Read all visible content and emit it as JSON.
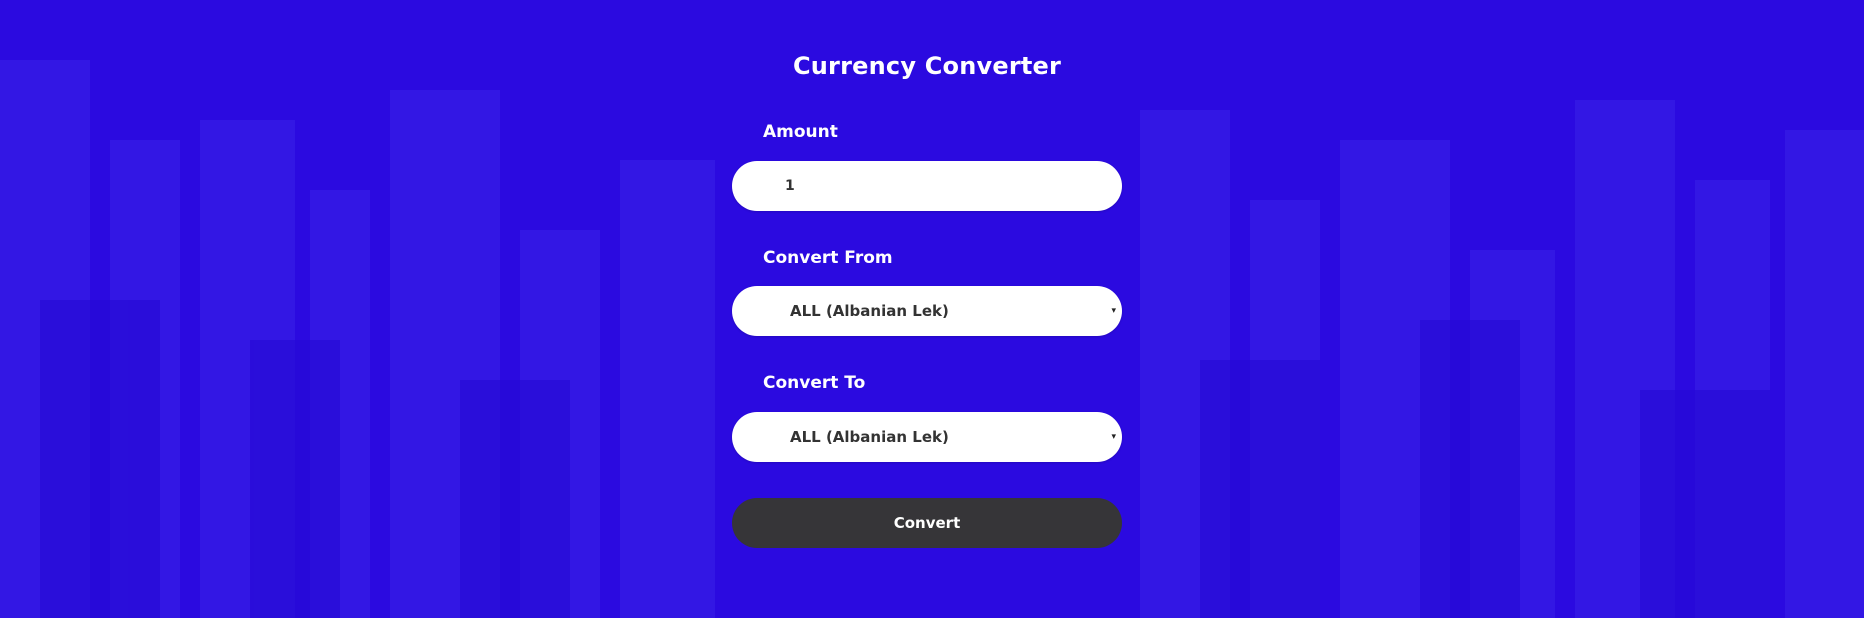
{
  "page": {
    "title": "Currency Converter",
    "background_color": "#2b0ae0",
    "button_color": "#363538"
  },
  "form": {
    "amount_label": "Amount",
    "amount_value": "1",
    "from_label": "Convert From",
    "from_value": "ALL (Albanian Lek)",
    "to_label": "Convert To",
    "to_value": "ALL (Albanian Lek)",
    "dropdown_arrow": "▾",
    "convert_button": "Convert"
  }
}
